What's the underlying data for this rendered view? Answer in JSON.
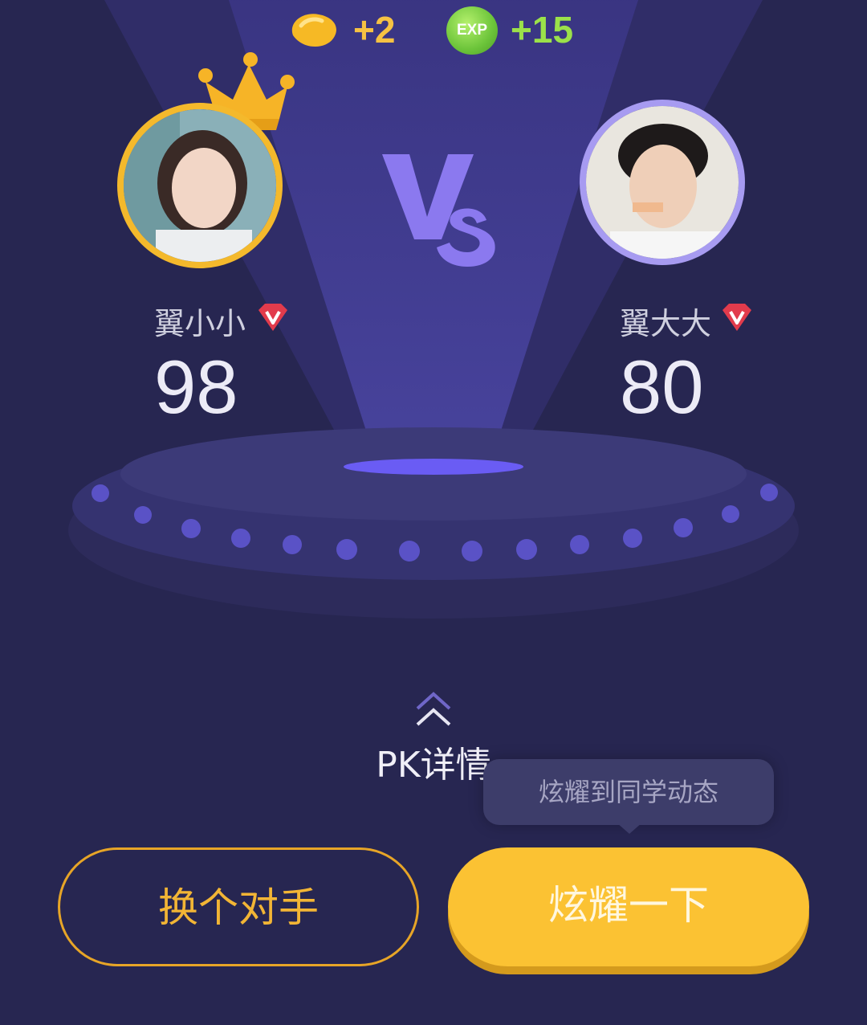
{
  "rewards": {
    "coin_icon": "bean-icon",
    "coin_amount": "+2",
    "exp_badge": "EXP",
    "exp_amount": "+15"
  },
  "vs_label": "Vs",
  "players": {
    "left": {
      "name": "翼小小",
      "score": "98",
      "has_crown": true,
      "ring_color": "#f4b92c"
    },
    "right": {
      "name": "翼大大",
      "score": "80",
      "has_crown": false,
      "ring_color": "#a79bf1"
    }
  },
  "pk_details_label": "PK详情",
  "tooltip": "炫耀到同学动态",
  "buttons": {
    "switch_opponent": "换个对手",
    "show_off": "炫耀一下"
  },
  "colors": {
    "background": "#272651",
    "accent_gold": "#fbc233",
    "exp_green": "#9be14a",
    "platform": "#3a3770"
  }
}
